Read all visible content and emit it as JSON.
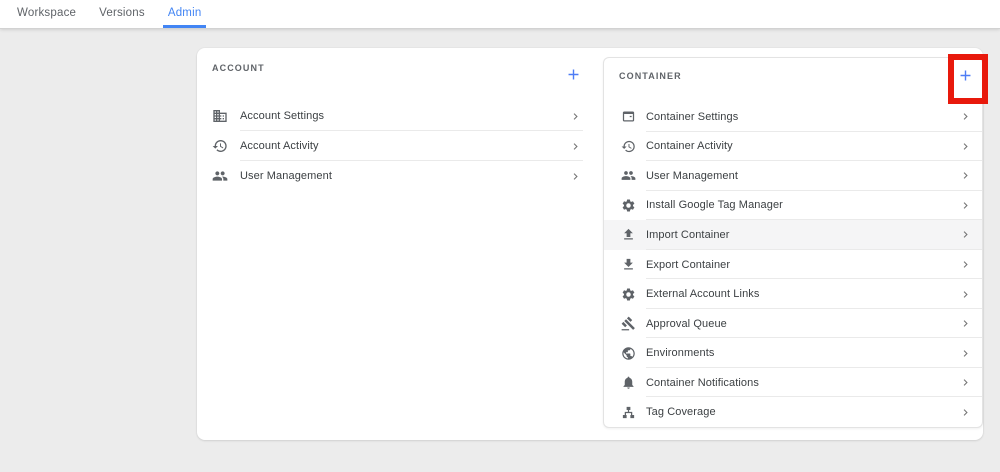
{
  "nav": {
    "tabs": [
      {
        "label": "Workspace",
        "active": false
      },
      {
        "label": "Versions",
        "active": false
      },
      {
        "label": "Admin",
        "active": true
      }
    ]
  },
  "panels": {
    "account": {
      "title": "ACCOUNT",
      "items": [
        {
          "label": "Account Settings",
          "icon": "business"
        },
        {
          "label": "Account Activity",
          "icon": "history"
        },
        {
          "label": "User Management",
          "icon": "group"
        }
      ]
    },
    "container": {
      "title": "CONTAINER",
      "items": [
        {
          "label": "Container Settings",
          "icon": "web-asset"
        },
        {
          "label": "Container Activity",
          "icon": "history"
        },
        {
          "label": "User Management",
          "icon": "group"
        },
        {
          "label": "Install Google Tag Manager",
          "icon": "gear"
        },
        {
          "label": "Import Container",
          "icon": "upload",
          "highlighted": true
        },
        {
          "label": "Export Container",
          "icon": "download"
        },
        {
          "label": "External Account Links",
          "icon": "gear"
        },
        {
          "label": "Approval Queue",
          "icon": "gavel"
        },
        {
          "label": "Environments",
          "icon": "globe"
        },
        {
          "label": "Container Notifications",
          "icon": "bell"
        },
        {
          "label": "Tag Coverage",
          "icon": "sitemap"
        }
      ]
    }
  },
  "annotation": {
    "shape": "red-box",
    "target": "container-add-button"
  },
  "colors": {
    "accent_blue": "#4285f4",
    "plus_blue": "#4e7cf5",
    "annotation_red": "#e8190c",
    "icon_gray": "#5f6368",
    "row_highlight": "#f5f5f6"
  }
}
